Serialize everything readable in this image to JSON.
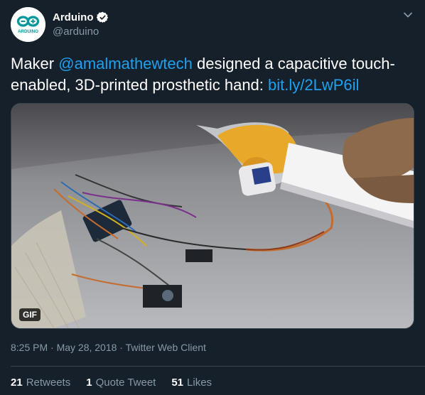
{
  "tweet": {
    "display_name": "Arduino",
    "handle": "@arduino",
    "avatar_text": "ARDUINO",
    "text_prefix": "Maker ",
    "mention": "@amalmathewtech",
    "text_middle": " designed a capacitive touch-enabled, 3D-printed prosthetic hand: ",
    "link": "bit.ly/2LwP6il",
    "media_badge": "GIF",
    "timestamp": "8:25 PM · May 28, 2018 · Twitter Web Client"
  },
  "stats": [
    {
      "count": "21",
      "label": "Retweets"
    },
    {
      "count": "1",
      "label": "Quote Tweet"
    },
    {
      "count": "51",
      "label": "Likes"
    }
  ],
  "colors": {
    "background": "#15202b",
    "link": "#1da1f2",
    "muted": "#8899a6",
    "brand": "#00979c"
  }
}
